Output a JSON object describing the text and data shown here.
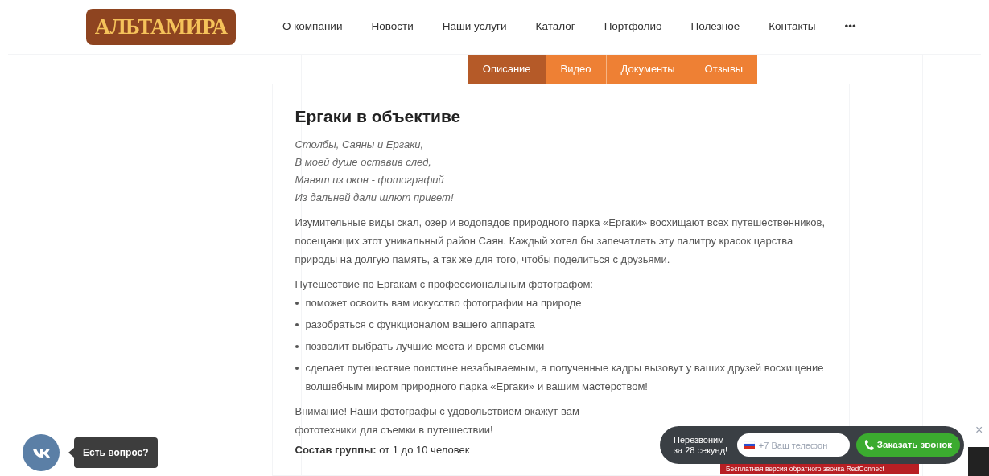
{
  "logo": "АЛЬТАМИРА",
  "nav": [
    {
      "label": "О компании"
    },
    {
      "label": "Новости"
    },
    {
      "label": "Наши услуги"
    },
    {
      "label": "Каталог"
    },
    {
      "label": "Портфолио"
    },
    {
      "label": "Полезное"
    },
    {
      "label": "Контакты"
    },
    {
      "label": "•••"
    }
  ],
  "tabs": [
    {
      "label": "Описание",
      "selected": true
    },
    {
      "label": "Видео",
      "selected": false
    },
    {
      "label": "Документы",
      "selected": false
    },
    {
      "label": "Отзывы",
      "selected": false
    }
  ],
  "article": {
    "title": "Ергаки в объективе",
    "poem": [
      "Столбы, Саяны и Ергаки,",
      "В моей душе оставив след,",
      "Манят из окон - фотографий",
      "Из дальней дали шлют привет!"
    ],
    "intro": "Изумительные виды скал, озер и водопадов природного парка «Ергаки» восхищают всех путешественников, посещающих этот уникальный район Саян. Каждый хотел бы запечатлеть эту палитру красок царства природы на долгую память, а так же для того, чтобы поделиться с друзьями.",
    "list_lead": "Путешествие по Ергакам с профессиональным фотографом:",
    "bullets": [
      "поможет освоить вам искусство фотографии на природе",
      "разобраться с функционалом вашего аппарата",
      "позволит выбрать лучшие места и время съемки",
      "сделает путешествие поистине незабываемым, а полученные кадры вызовут у ваших друзей восхищение волшебным миром природного парка «Ергаки» и вашим мастерством!"
    ],
    "note": [
      "Внимание! Наши фотографы с удовольствием окажут вам",
      "фототехники для съемки в путешествии!"
    ],
    "group": "**Состав группы:** от 1 до 10 человек"
  },
  "vk_tooltip": "Есть вопрос?",
  "callback": {
    "caption": "Перезвоним за 28 секунд!",
    "placeholder": "+7 Ваш телефон",
    "button": "Заказать звонок",
    "footer": "Бесплатная версия обратного звонка RedConnect",
    "close": "×"
  }
}
